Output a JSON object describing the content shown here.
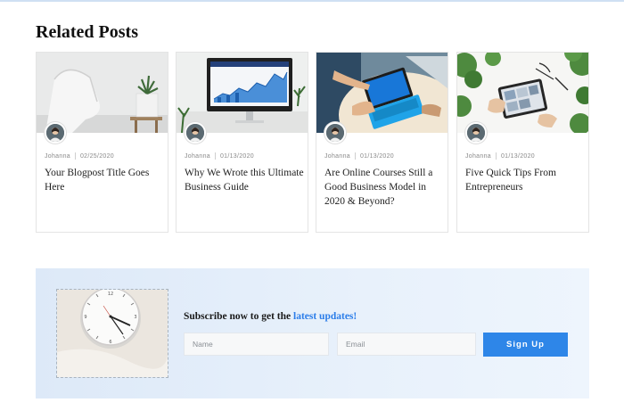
{
  "section": {
    "title": "Related Posts"
  },
  "posts": [
    {
      "author": "Johanna",
      "date": "02/25/2020",
      "title": "Your Blogpost Title Goes Here",
      "image": "white-chair-photo"
    },
    {
      "author": "Johanna",
      "date": "01/13/2020",
      "title": "Why We Wrote this Ultimate Business Guide",
      "image": "monitor-chart-photo"
    },
    {
      "author": "Johanna",
      "date": "01/13/2020",
      "title": "Are Online Courses Still a Good Business Model in 2020 & Beyond?",
      "image": "laptop-desk-photo"
    },
    {
      "author": "Johanna",
      "date": "01/13/2020",
      "title": "Five Quick Tips From Entrepreneurs",
      "image": "tablet-plants-photo"
    }
  ],
  "subscribe": {
    "heading_prefix": "Subscribe now to get the",
    "heading_accent": "latest updates!",
    "name_placeholder": "Name",
    "email_placeholder": "Email",
    "button_label": "Sign Up",
    "image": "wall-clock-photo",
    "accent_color": "#2e86e8"
  }
}
